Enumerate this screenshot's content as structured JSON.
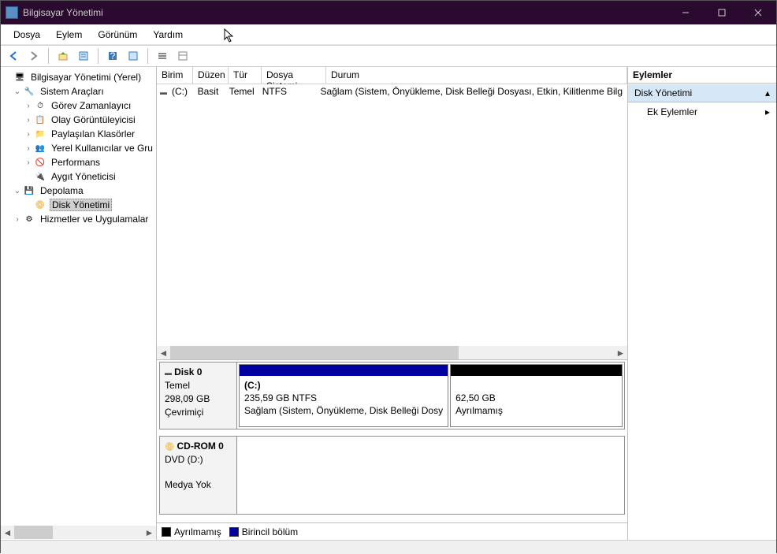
{
  "window": {
    "title": "Bilgisayar Yönetimi"
  },
  "menu": {
    "file": "Dosya",
    "action": "Eylem",
    "view": "Görünüm",
    "help": "Yardım"
  },
  "tree": {
    "root": "Bilgisayar Yönetimi (Yerel)",
    "systools": "Sistem Araçları",
    "scheduler": "Görev Zamanlayıcı",
    "eventviewer": "Olay Görüntüleyicisi",
    "sharedfolders": "Paylaşılan Klasörler",
    "localusers": "Yerel Kullanıcılar ve Gru",
    "performance": "Performans",
    "devmgr": "Aygıt Yöneticisi",
    "storage": "Depolama",
    "diskmgmt": "Disk Yönetimi",
    "services": "Hizmetler ve Uygulamalar"
  },
  "columns": {
    "volume": "Birim",
    "layout": "Düzen",
    "type": "Tür",
    "filesystem": "Dosya Sistemi",
    "status": "Durum"
  },
  "volumes": [
    {
      "name": "(C:)",
      "layout": "Basit",
      "type": "Temel",
      "fs": "NTFS",
      "status": "Sağlam (Sistem, Önyükleme, Disk Belleği Dosyası, Etkin, Kilitlenme Bilg"
    }
  ],
  "disks": [
    {
      "name": "Disk 0",
      "type": "Temel",
      "size": "298,09 GB",
      "status": "Çevrimiçi",
      "partitions": [
        {
          "label": "(C:)",
          "sizefs": "235,59 GB NTFS",
          "status": "Sağlam (Sistem, Önyükleme, Disk Belleği Dosy",
          "kind": "primary",
          "width": 52
        },
        {
          "label": "",
          "sizefs": "62,50 GB",
          "status": "Ayrılmamış",
          "kind": "unalloc",
          "width": 48
        }
      ]
    },
    {
      "name": "CD-ROM 0",
      "type": "DVD (D:)",
      "size": "",
      "status": "Medya Yok",
      "partitions": []
    }
  ],
  "legend": {
    "unalloc": "Ayrılmamış",
    "primary": "Birincil bölüm"
  },
  "actions": {
    "header": "Eylemler",
    "group": "Disk Yönetimi",
    "more": "Ek Eylemler"
  }
}
